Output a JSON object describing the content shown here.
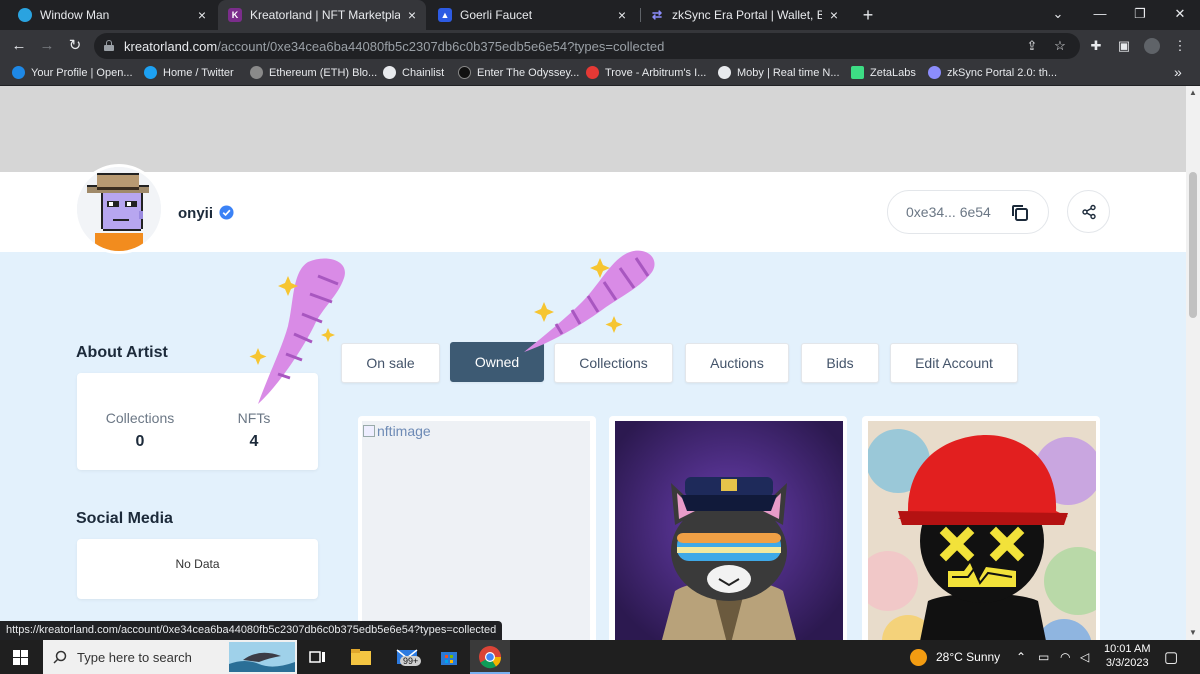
{
  "browser": {
    "tabs": [
      {
        "title": "Window Man",
        "fav_color": "#2aa3e0",
        "fav_glyph": ""
      },
      {
        "title": "Kreatorland | NFT Marketplace",
        "fav_color": "#7b2d8b",
        "fav_glyph": "K"
      },
      {
        "title": "Goerli Faucet",
        "fav_color": "#2d5be3",
        "fav_glyph": "▲"
      },
      {
        "title": "zkSync Era Portal | Wallet, Bridge",
        "fav_color": "#8c8dfc",
        "fav_glyph": "⇄"
      }
    ],
    "new_tab_glyph": "+",
    "url_host": "kreatorland.com",
    "url_path": "/account/0xe34cea6ba44080fb5c2307db6c0b375edb5e6e54?types=collected",
    "bookmarks": [
      {
        "label": "Your Profile | Open...",
        "color": "#1e88e5"
      },
      {
        "label": "Home / Twitter",
        "color": "#1da1f2"
      },
      {
        "label": "Ethereum (ETH) Blo...",
        "color": "#8a8a8a"
      },
      {
        "label": "Chainlist",
        "color": "#e8eaed"
      },
      {
        "label": "Enter The Odyssey...",
        "color": "#222222"
      },
      {
        "label": "Trove - Arbitrum's I...",
        "color": "#e53935"
      },
      {
        "label": "Moby | Real time N...",
        "color": "#e8eaed"
      },
      {
        "label": "ZetaLabs",
        "color": "#3ddc84"
      },
      {
        "label": "zkSync Portal 2.0: th...",
        "color": "#8c8dfc"
      }
    ],
    "status_url": "https://kreatorland.com/account/0xe34cea6ba44080fb5c2307db6c0b375edb5e6e54?types=collected"
  },
  "profile": {
    "username": "onyii",
    "address_short": "0xe34... 6e54"
  },
  "about": {
    "title": "About Artist",
    "collections_label": "Collections",
    "collections_value": "0",
    "nfts_label": "NFTs",
    "nfts_value": "4"
  },
  "social": {
    "title": "Social Media",
    "empty_text": "No Data"
  },
  "tabs": {
    "on_sale": "On sale",
    "owned": "Owned",
    "collections": "Collections",
    "auctions": "Auctions",
    "bids": "Bids",
    "edit_account": "Edit Account",
    "active": "owned"
  },
  "nfts": [
    {
      "alt": "nftimage",
      "broken": true
    },
    {
      "alt": "",
      "broken": false
    },
    {
      "alt": "",
      "broken": false
    }
  ],
  "taskbar": {
    "search_placeholder": "Type here to search",
    "badge": "99+",
    "weather": "28°C  Sunny",
    "time": "10:01 AM",
    "date": "3/3/2023"
  },
  "colors": {
    "accent": "#3d5a73",
    "page_bg": "#e3f1fc",
    "banner": "#d6d6d6"
  }
}
